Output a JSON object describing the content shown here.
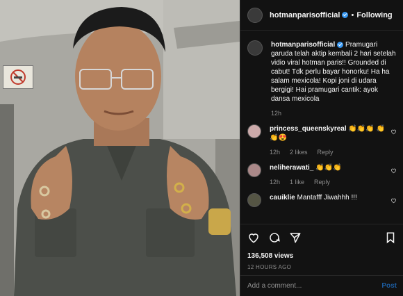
{
  "post": {
    "username": "hotmanparisofficial",
    "follow_label": "Following",
    "separator": "•",
    "caption": "Pramugari garuda telah aktip kembali 2 hari setelah vidio viral hotman paris!! Grounded di cabut! Tdk perlu bayar honorku! Ha ha salam mexicola! Kopi joni di udara bergigi! Hai pramugari cantik: ayok dansa mexicola",
    "caption_time": "12h",
    "views": "136,508 views",
    "timestamp": "12 HOURS AGO"
  },
  "comments": [
    {
      "username": "princess_queenskyreal",
      "text": "👏👏👏 👏👏😍",
      "time": "12h",
      "likes": "2 likes",
      "reply": "Reply"
    },
    {
      "username": "neliherawati_",
      "text": "👏👏👏",
      "time": "12h",
      "likes": "1 like",
      "reply": "Reply"
    },
    {
      "username": "cauiklie",
      "text": "Mantafff Jiwahhh !!!",
      "time": "",
      "likes": "",
      "reply": ""
    }
  ],
  "add_comment": {
    "placeholder": "Add a comment...",
    "post_label": "Post"
  },
  "icons": [
    "heart-icon",
    "comment-icon",
    "share-icon",
    "bookmark-icon"
  ],
  "colors": {
    "background": "#121212",
    "verified": "#3897f0",
    "muted": "#8e8e8e",
    "post_button": "#1c5ca0"
  }
}
